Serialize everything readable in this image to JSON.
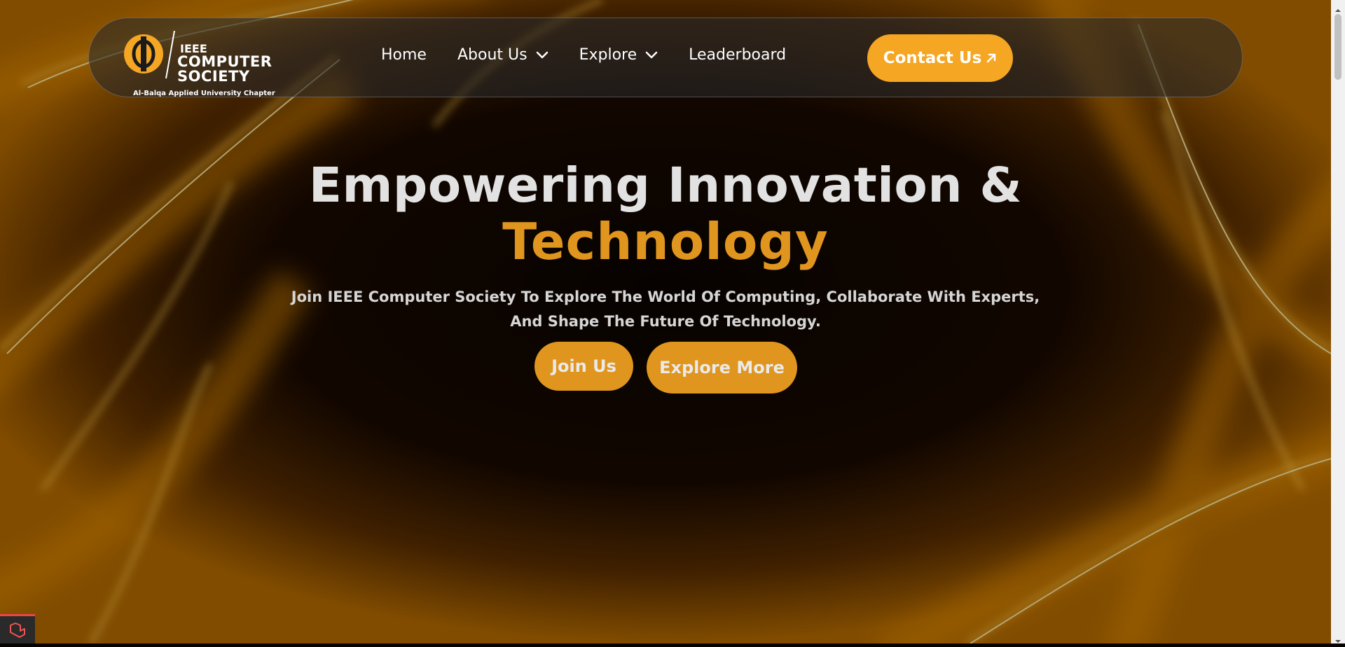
{
  "logo": {
    "ieee": "IEEE",
    "line1": "COMPUTER",
    "line2": "SOCIETY",
    "chapter": "Al-Balqa Applied University Chapter",
    "icon": "ieee-cs-logo-icon"
  },
  "nav": {
    "items": [
      {
        "label": "Home",
        "has_dropdown": false
      },
      {
        "label": "About Us",
        "has_dropdown": true
      },
      {
        "label": "Explore",
        "has_dropdown": true
      },
      {
        "label": "Leaderboard",
        "has_dropdown": false
      }
    ],
    "contact_label": "Contact Us",
    "contact_icon": "arrow-up-right-icon"
  },
  "hero": {
    "title_line1": "Empowering Innovation &",
    "title_line2": "Technology",
    "subtitle": "Join IEEE Computer Society To Explore The World Of Computing, Collaborate With Experts, And Shape The Future Of Technology.",
    "join_label": "Join Us",
    "explore_label": "Explore More"
  },
  "colors": {
    "accent": "#f5a623",
    "accent_dark": "#e0951f",
    "background": "#060300"
  }
}
